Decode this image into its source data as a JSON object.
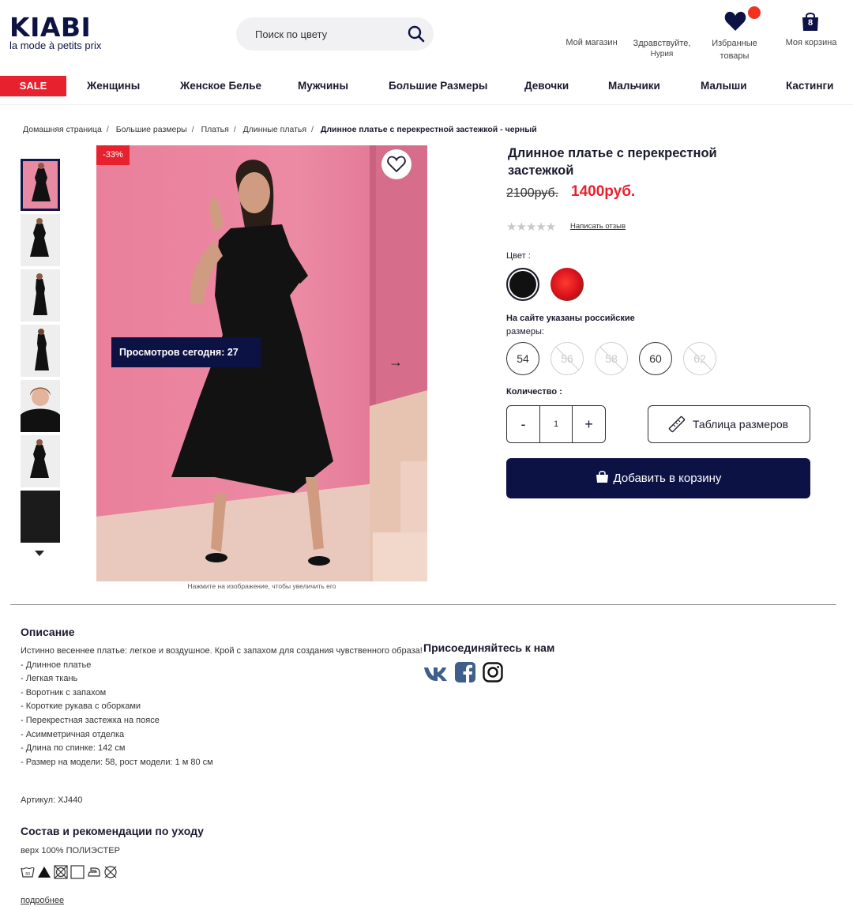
{
  "header": {
    "logo_word": "KIABI",
    "logo_tag": "la mode à petits prix",
    "search_placeholder": "Поиск по цвету",
    "my_store": "Мой магазин",
    "greeting_line1": "Здравствуйте,",
    "greeting_line2": "Нурия",
    "favorites_line1": "Избранные",
    "favorites_line2": "товары",
    "cart_label": "Моя корзина",
    "cart_count": "8"
  },
  "nav": {
    "sale": "SALE",
    "items": [
      "Женщины",
      "Женское Белье",
      "Мужчины",
      "Большие Размеры",
      "Девочки",
      "Мальчики",
      "Малыши",
      "Кастинги"
    ]
  },
  "breadcrumb": {
    "items": [
      "Домашняя страница",
      "Большие размеры",
      "Платья",
      "Длинные платья"
    ],
    "current": "Длинное платье с перекрестной застежкой - черный"
  },
  "gallery": {
    "discount": "-33%",
    "views_today": "Просмотров сегодня: 27",
    "hint": "Нажмите на изображение, чтобы увеличить его"
  },
  "product": {
    "title": "Длинное платье с перекрестной застежкой",
    "old_price": "2100руб.",
    "new_price": "1400руб.",
    "rating": 0,
    "review_link": "Написать отзыв",
    "color_label": "Цвет :",
    "colors": [
      {
        "name": "black",
        "hex": "#111111",
        "selected": true
      },
      {
        "name": "red-floral",
        "hex": "#e8201c",
        "selected": false
      }
    ],
    "sizes_label_line1": "На сайте указаны российские",
    "sizes_label_line2": "размеры:",
    "sizes": [
      {
        "label": "54",
        "available": true
      },
      {
        "label": "56",
        "available": false
      },
      {
        "label": "58",
        "available": false
      },
      {
        "label": "60",
        "available": true
      },
      {
        "label": "62",
        "available": false
      }
    ],
    "qty_label": "Количество :",
    "qty_minus": "-",
    "qty_value": "1",
    "qty_plus": "+",
    "size_table": "Таблица размеров",
    "add_to_cart": "Добавить в корзину"
  },
  "description": {
    "heading": "Описание",
    "lines": [
      "Истинно весеннее платье: легкое и воздушное. Крой с запахом для создания чувственного образа!",
      "- Длинное платье",
      "- Легкая ткань",
      "- Воротник с запахом",
      "- Короткие рукава с оборками",
      "- Перекрестная застежка на поясе",
      "- Асимметричная отделка",
      "- Длина по спинке: 142 см",
      "- Размер на модели: 58, рост модели: 1 м 80 см"
    ],
    "article": "Артикул: XJ440",
    "composition_heading": "Состав и рекомендации по уходу",
    "composition": "верх 100% ПОЛИЭСТЕР",
    "more_link": "подробнее"
  },
  "social": {
    "heading": "Присоединяйтесь к нам",
    "icons": [
      "vk-icon",
      "facebook-icon",
      "instagram-icon"
    ]
  },
  "colors": {
    "brand": "#0d1245",
    "sale": "#e8212e"
  }
}
